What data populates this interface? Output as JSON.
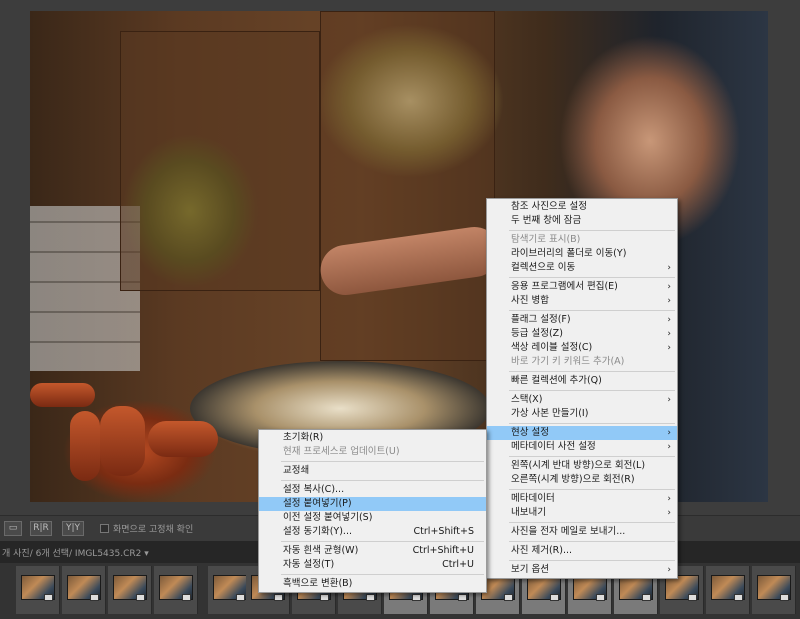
{
  "toolbar": {
    "view_btn_1": "▭",
    "view_btn_2": "R|R",
    "view_btn_3": "Y|Y",
    "lock_label": "화면으로 고정채 확인"
  },
  "filmstrip": {
    "status": "개 사진/ 6개 선택/ IMGL5435.CR2 ▾"
  },
  "main_menu": {
    "items": [
      {
        "label": "참조 사진으로 설정",
        "disabled": false,
        "submenu": false
      },
      {
        "label": "두 번째 창에 잠금",
        "disabled": false,
        "submenu": false
      },
      {
        "sep": true
      },
      {
        "label": "탐색기로 표시(B)",
        "disabled": true,
        "submenu": false
      },
      {
        "label": "라이브러리의 폴더로 이동(Y)",
        "disabled": false,
        "submenu": false
      },
      {
        "label": "컬렉션으로 이동",
        "disabled": false,
        "submenu": true
      },
      {
        "sep": true
      },
      {
        "label": "응용 프로그램에서 편집(E)",
        "disabled": false,
        "submenu": true
      },
      {
        "label": "사진 병합",
        "disabled": false,
        "submenu": true
      },
      {
        "sep": true
      },
      {
        "label": "플래그 설정(F)",
        "disabled": false,
        "submenu": true
      },
      {
        "label": "등급 설정(Z)",
        "disabled": false,
        "submenu": true
      },
      {
        "label": "색상 레이블 설정(C)",
        "disabled": false,
        "submenu": true
      },
      {
        "label": "바로 가기 키 키워드 추가(A)",
        "disabled": true,
        "submenu": false
      },
      {
        "sep": true
      },
      {
        "label": "빠른 컬렉션에 추가(Q)",
        "disabled": false,
        "submenu": false
      },
      {
        "sep": true
      },
      {
        "label": "스택(X)",
        "disabled": false,
        "submenu": true
      },
      {
        "label": "가상 사본 만들기(I)",
        "disabled": false,
        "submenu": false
      },
      {
        "sep": true
      },
      {
        "label": "현상 설정",
        "disabled": false,
        "submenu": true,
        "highlight": true
      },
      {
        "label": "메타데이터 사전 설정",
        "disabled": false,
        "submenu": true
      },
      {
        "sep": true
      },
      {
        "label": "왼쪽(시계 반대 방향)으로 회전(L)",
        "disabled": false,
        "submenu": false
      },
      {
        "label": "오른쪽(시계 방향)으로 회전(R)",
        "disabled": false,
        "submenu": false
      },
      {
        "sep": true
      },
      {
        "label": "메타데이터",
        "disabled": false,
        "submenu": true
      },
      {
        "label": "내보내기",
        "disabled": false,
        "submenu": true
      },
      {
        "sep": true
      },
      {
        "label": "사진을 전자 메일로 보내기...",
        "disabled": false,
        "submenu": false
      },
      {
        "sep": true
      },
      {
        "label": "사진 제거(R)...",
        "disabled": false,
        "submenu": false
      },
      {
        "sep": true
      },
      {
        "label": "보기 옵션",
        "disabled": false,
        "submenu": true
      }
    ]
  },
  "sub_menu": {
    "items": [
      {
        "label": "초기화(R)",
        "disabled": false
      },
      {
        "label": "현재 프로세스로 업데이트(U)",
        "disabled": true
      },
      {
        "sep": true
      },
      {
        "label": "교정쇄",
        "disabled": false
      },
      {
        "sep": true
      },
      {
        "label": "설정 복사(C)...",
        "disabled": false
      },
      {
        "label": "설정 붙여넣기(P)",
        "disabled": false,
        "highlight": true
      },
      {
        "label": "이전 설정 붙여넣기(S)",
        "disabled": false
      },
      {
        "label": "설정 동기화(Y)...",
        "disabled": false,
        "shortcut": "Ctrl+Shift+S"
      },
      {
        "sep": true
      },
      {
        "label": "자동 흰색 균형(W)",
        "disabled": false,
        "shortcut": "Ctrl+Shift+U"
      },
      {
        "label": "자동 설정(T)",
        "disabled": false,
        "shortcut": "Ctrl+U"
      },
      {
        "sep": true
      },
      {
        "label": "흑백으로 변환(B)",
        "disabled": false
      }
    ]
  },
  "icons": {
    "submenu_arrow": "›"
  }
}
